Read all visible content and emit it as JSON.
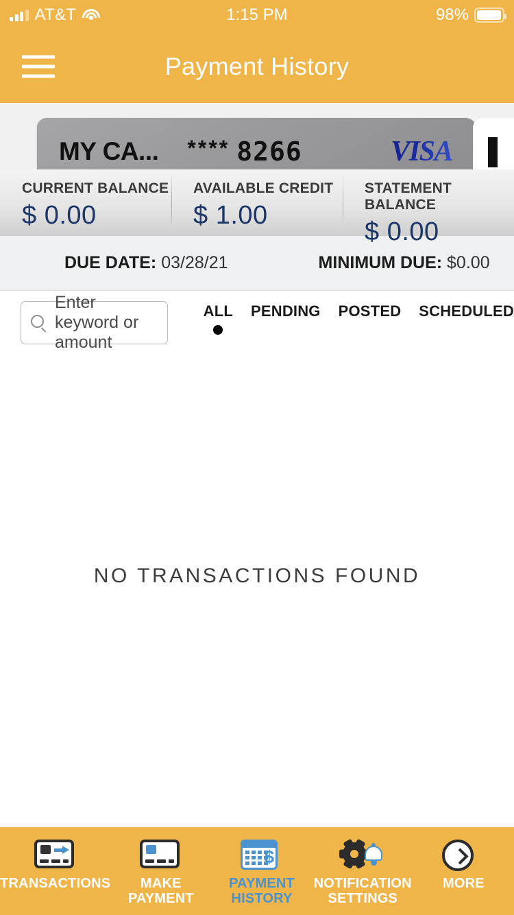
{
  "statusbar": {
    "carrier": "AT&T",
    "time": "1:15 PM",
    "battery_percent": "98%",
    "signal_icon": "signal-bars-icon",
    "wifi_icon": "wifi-icon",
    "battery_icon": "battery-icon"
  },
  "navbar": {
    "title": "Payment History",
    "menu_icon": "hamburger-menu-icon"
  },
  "card": {
    "nickname": "MY CA...",
    "mask": "****",
    "last_four": "8266",
    "brand": "VISA"
  },
  "balances": [
    {
      "label": "CURRENT BALANCE",
      "value": "$ 0.00"
    },
    {
      "label": "AVAILABLE CREDIT",
      "value": "$ 1.00"
    },
    {
      "label": "STATEMENT BALANCE",
      "value": "$ 0.00"
    }
  ],
  "due": {
    "due_date_label": "DUE DATE:",
    "due_date_value": "03/28/21",
    "minimum_due_label": "MINIMUM DUE:",
    "minimum_due_value": "$0.00"
  },
  "search": {
    "placeholder": "Enter keyword or amount",
    "value": "",
    "icon": "search-icon"
  },
  "filters": [
    {
      "label": "ALL",
      "selected": true
    },
    {
      "label": "PENDING",
      "selected": false
    },
    {
      "label": "POSTED",
      "selected": false
    },
    {
      "label": "SCHEDULED",
      "selected": false
    }
  ],
  "empty_state": {
    "message": "NO TRANSACTIONS FOUND"
  },
  "tabbar": [
    {
      "label": "TRANSACTIONS",
      "icon": "card-arrow-icon",
      "active": false
    },
    {
      "label": "MAKE PAYMENT",
      "icon": "credit-card-icon",
      "active": false
    },
    {
      "label": "PAYMENT\nHISTORY",
      "line1": "PAYMENT",
      "line2": "HISTORY",
      "icon": "calendar-dollar-icon",
      "active": true
    },
    {
      "label": "NOTIFICATION\nSETTINGS",
      "line1": "NOTIFICATION",
      "line2": "SETTINGS",
      "icon": "gear-bell-icon",
      "active": false
    },
    {
      "label": "MORE",
      "icon": "chevron-right-circle-icon",
      "active": false
    }
  ],
  "colors": {
    "brand_orange": "#efb549",
    "accent_blue": "#4a93cf",
    "value_navy": "#1c3668",
    "visa_blue": "#1a2b9e"
  }
}
